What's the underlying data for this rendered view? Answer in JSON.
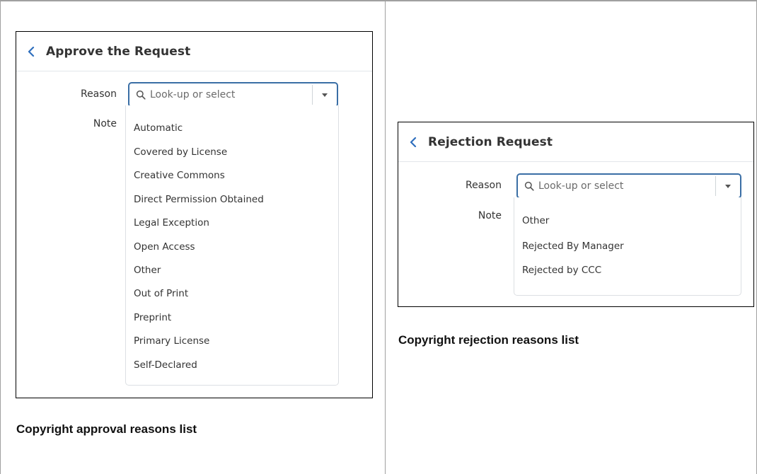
{
  "approve": {
    "title": "Approve the Request",
    "reason_label": "Reason",
    "note_label": "Note",
    "search_placeholder": "Look-up or select",
    "options": [
      "Automatic",
      "Covered by License",
      "Creative Commons",
      "Direct Permission Obtained",
      "Legal Exception",
      "Open Access",
      "Other",
      "Out of Print",
      "Preprint",
      "Primary License",
      "Self-Declared"
    ],
    "caption": "Copyright approval reasons list"
  },
  "reject": {
    "title": "Rejection Request",
    "reason_label": "Reason",
    "note_label": "Note",
    "search_placeholder": "Look-up or select",
    "options": [
      "Other",
      "Rejected By Manager",
      "Rejected by CCC"
    ],
    "caption": "Copyright rejection reasons list"
  },
  "colors": {
    "accent": "#3a6ea5",
    "chevron": "#2f6fbd"
  },
  "icons": {
    "back": "chevron-left-icon",
    "search": "search-icon",
    "dropdown": "caret-down-icon"
  }
}
